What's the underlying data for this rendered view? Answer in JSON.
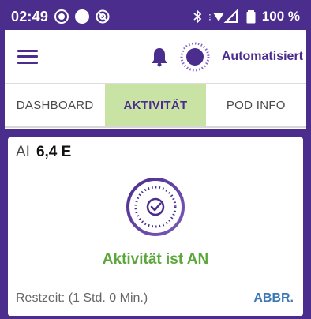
{
  "status_bar": {
    "time": "02:49",
    "battery": "100 %"
  },
  "header": {
    "mode": "Automatisiert"
  },
  "tabs": [
    {
      "label": "DASHBOARD",
      "active": false
    },
    {
      "label": "AKTIVITÄT",
      "active": true
    },
    {
      "label": "POD INFO",
      "active": false
    }
  ],
  "card": {
    "ai_label": "AI",
    "ai_value": "6,4 E",
    "status": "Aktivität ist AN",
    "remaining": "Restzeit: (1 Std. 0 Min.)",
    "abort_label": "ABBR."
  },
  "colors": {
    "brand": "#4b2d8e",
    "active_tab": "#c9e3a4",
    "status_green": "#5ca73c",
    "link_blue": "#3d78b5"
  },
  "icons": [
    "menu-icon",
    "bell-icon",
    "automated-mode-icon",
    "activity-check-icon",
    "bluetooth-icon",
    "signal-icon",
    "battery-icon"
  ]
}
